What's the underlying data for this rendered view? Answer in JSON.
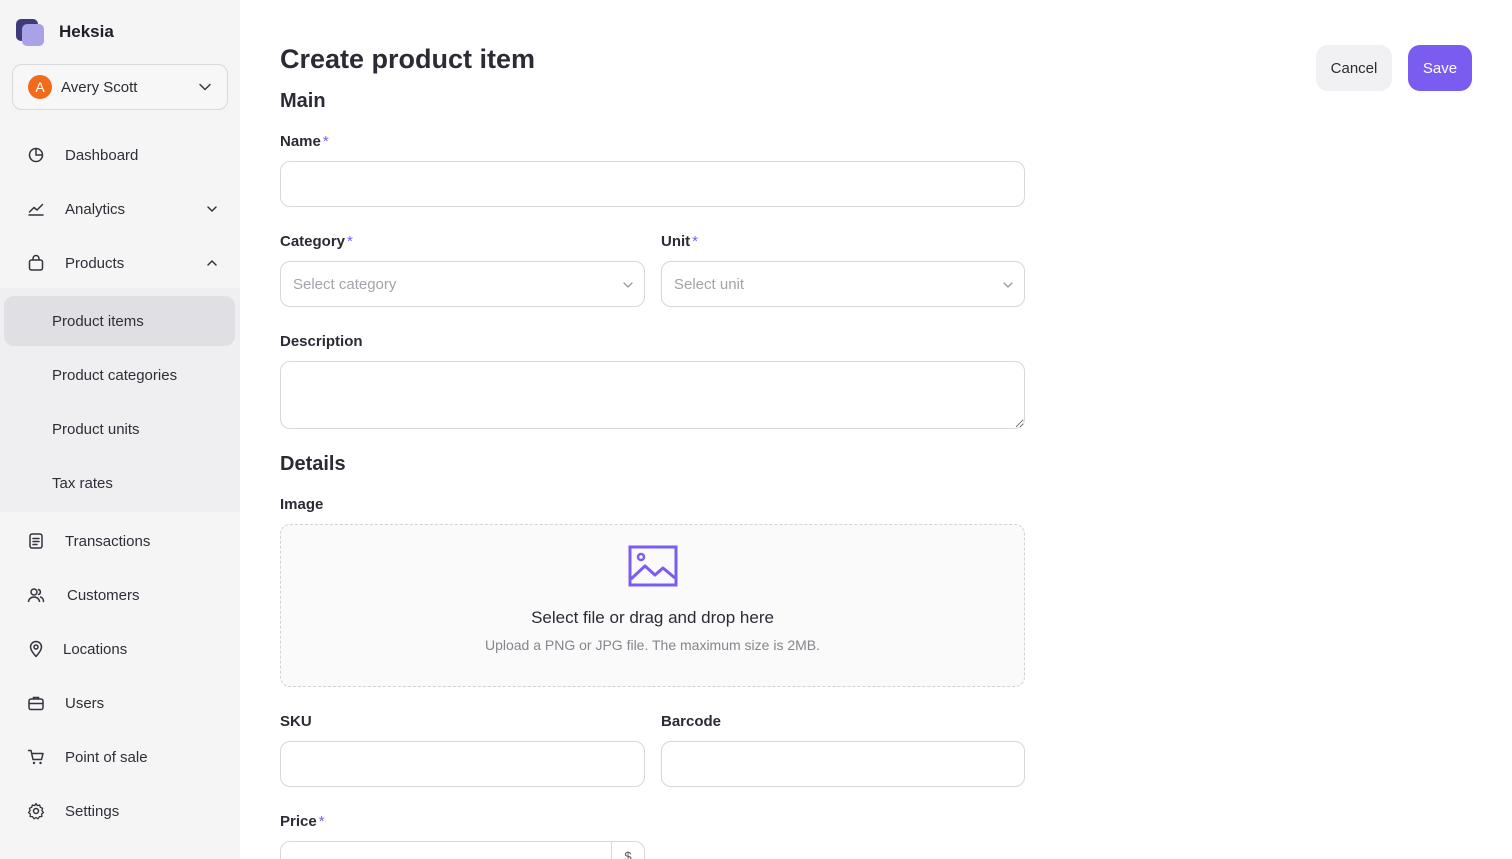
{
  "brand": {
    "name": "Heksia"
  },
  "user": {
    "initial": "A",
    "name": "Avery Scott",
    "avatar_color": "#f26b1d"
  },
  "sidebar": {
    "items": [
      {
        "label": "Dashboard",
        "icon": "pie-chart-icon"
      },
      {
        "label": "Analytics",
        "icon": "line-chart-icon"
      },
      {
        "label": "Products",
        "icon": "shopping-bag-icon"
      },
      {
        "label": "Transactions",
        "icon": "document-icon"
      },
      {
        "label": "Customers",
        "icon": "users-icon"
      },
      {
        "label": "Locations",
        "icon": "map-pin-icon"
      },
      {
        "label": "Users",
        "icon": "briefcase-icon"
      },
      {
        "label": "Point of sale",
        "icon": "cart-icon"
      },
      {
        "label": "Settings",
        "icon": "gear-icon"
      }
    ],
    "products_sub": [
      {
        "label": "Product items",
        "active": true
      },
      {
        "label": "Product categories"
      },
      {
        "label": "Product units"
      },
      {
        "label": "Tax rates"
      }
    ]
  },
  "page": {
    "title": "Create product item"
  },
  "actions": {
    "cancel": "Cancel",
    "save": "Save"
  },
  "colors": {
    "accent": "#7a5cf0",
    "sidebar_bg": "#f5f5f6",
    "active_item": "#e0e0e4"
  },
  "form": {
    "main_title": "Main",
    "details_title": "Details",
    "name": {
      "label": "Name",
      "required": "*",
      "value": ""
    },
    "category": {
      "label": "Category",
      "required": "*",
      "placeholder": "Select category"
    },
    "unit": {
      "label": "Unit",
      "required": "*",
      "placeholder": "Select unit"
    },
    "description": {
      "label": "Description",
      "value": ""
    },
    "image": {
      "label": "Image",
      "title": "Select file or drag and drop here",
      "hint": "Upload a PNG or JPG file. The maximum size is 2MB.",
      "icon": "image-icon"
    },
    "sku": {
      "label": "SKU",
      "value": ""
    },
    "barcode": {
      "label": "Barcode",
      "value": ""
    },
    "price": {
      "label": "Price",
      "required": "*",
      "value": "",
      "addon": "$"
    }
  }
}
